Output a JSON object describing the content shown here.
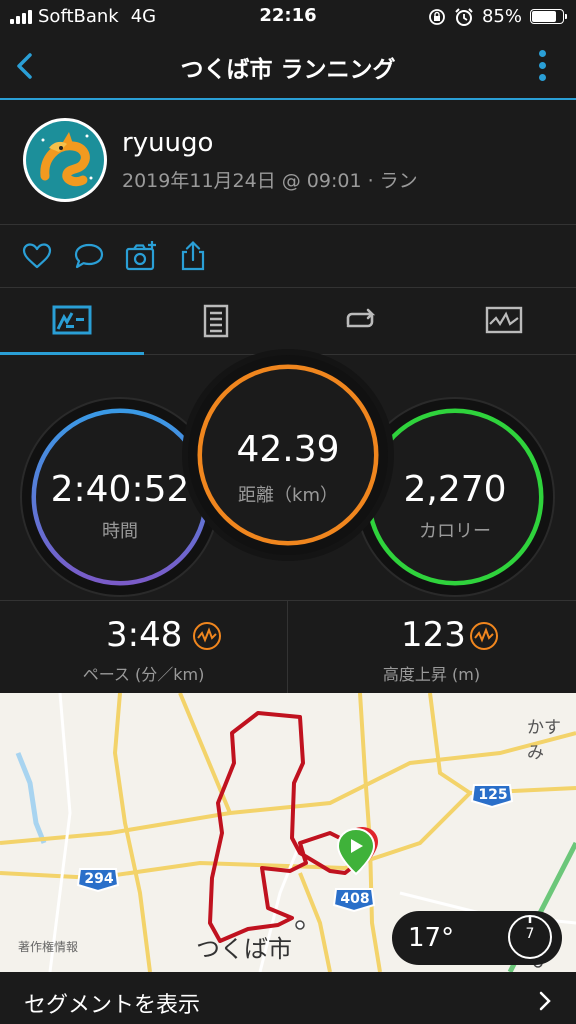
{
  "status_bar": {
    "carrier": "SoftBank",
    "network": "4G",
    "time": "22:16",
    "battery": "85%",
    "battery_level": 0.85
  },
  "nav": {
    "title": "つくば市 ランニング",
    "back_icon": "chevron-left-icon",
    "menu_icon": "more-vertical-icon"
  },
  "activity": {
    "user_name": "ryuugo",
    "subtitle": "2019年11月24日 @ 09:01 · ラン"
  },
  "actions": [
    {
      "icon": "heart-icon"
    },
    {
      "icon": "comment-icon"
    },
    {
      "icon": "add-photo-icon"
    },
    {
      "icon": "share-icon"
    }
  ],
  "tabs": [
    {
      "icon": "stats-icon",
      "active": true
    },
    {
      "icon": "details-icon",
      "active": false
    },
    {
      "icon": "laps-icon",
      "active": false
    },
    {
      "icon": "charts-icon",
      "active": false
    }
  ],
  "stats": {
    "time": {
      "value": "2:40:52",
      "label": "時間"
    },
    "distance": {
      "value": "42.39",
      "label": "距離（km）"
    },
    "calories": {
      "value": "2,270",
      "label": "カロリー"
    }
  },
  "metrics": {
    "pace": {
      "value": "3:48",
      "label": "ペース (分／km)"
    },
    "elevation": {
      "value": "123",
      "label": "高度上昇 (m)"
    }
  },
  "map": {
    "city_label": "つくば市",
    "place_label": "かすみ",
    "copyright": "著作権情報",
    "routes": [
      "294",
      "408",
      "125"
    ],
    "temperature": "17°",
    "wind": "7",
    "route_color": "#c0121f"
  },
  "segment": {
    "label": "セグメントを表示"
  },
  "colors": {
    "accent": "#2a9fd6",
    "time_ring": "#3d8fe0",
    "distance_ring": "#f0861e",
    "calories_ring": "#2fd33c"
  }
}
